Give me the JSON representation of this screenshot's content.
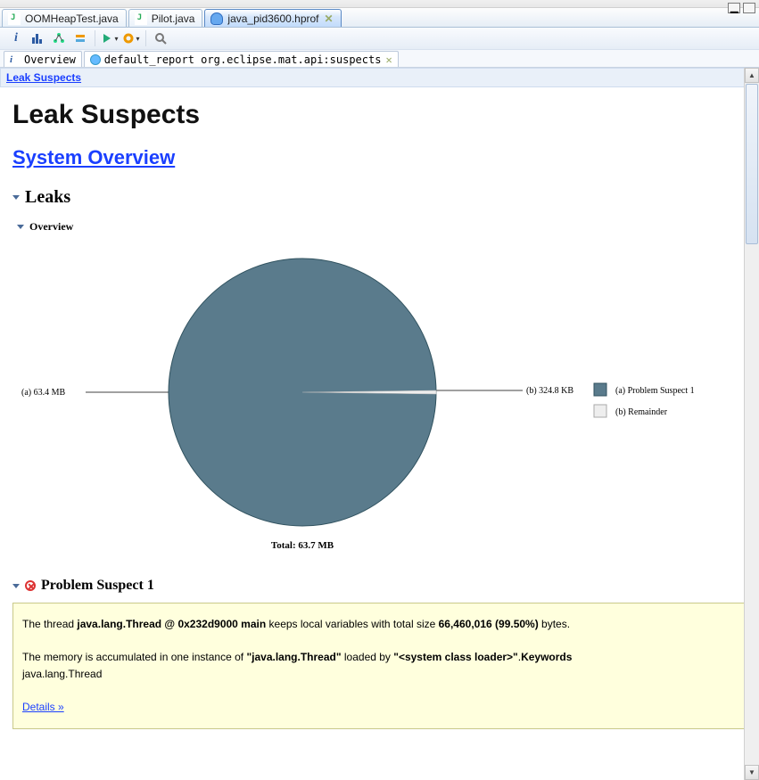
{
  "tabs": [
    {
      "label": "OOMHeapTest.java",
      "icon": "j"
    },
    {
      "label": "Pilot.java",
      "icon": "j"
    },
    {
      "label": "java_pid3600.hprof",
      "icon": "db",
      "active": true,
      "closable": true
    }
  ],
  "subtabs": [
    {
      "label": "Overview",
      "icon": "i"
    },
    {
      "label": "default_report  org.eclipse.mat.api:suspects",
      "icon": "db",
      "closable": true
    }
  ],
  "breadcrumb": {
    "label": "Leak Suspects"
  },
  "page_title": "Leak Suspects",
  "system_overview_label": "System Overview",
  "sections": {
    "leaks": "Leaks",
    "overview": "Overview",
    "problem_suspect": "Problem Suspect 1"
  },
  "chart_data": {
    "type": "pie",
    "title": "Total: 63.7 MB",
    "series": [
      {
        "name": "(a) Problem Suspect 1",
        "label": "(a)  63.4 MB",
        "value": 63.4,
        "unit": "MB",
        "percent": 99.5,
        "color": "#5a7b8c"
      },
      {
        "name": "(b) Remainder",
        "label": "(b)  324.8 KB",
        "value": 0.3172,
        "unit": "MB",
        "percent": 0.5,
        "color": "#eeeeee"
      }
    ],
    "legend": [
      {
        "swatch": "#5a7b8c",
        "label": "(a)  Problem Suspect 1"
      },
      {
        "swatch": "#eeeeee",
        "label": "(b)  Remainder"
      }
    ]
  },
  "suspect": {
    "line1_pre": "The thread ",
    "line1_bold": "java.lang.Thread @ 0x232d9000 main",
    "line1_mid": " keeps local variables with total size ",
    "line1_size": "66,460,016 (99.50%)",
    "line1_post": " bytes.",
    "line2_pre": "The memory is accumulated in one instance of ",
    "line2_q1": "\"java.lang.Thread\"",
    "line2_mid": " loaded by ",
    "line2_q2": "\"<system class loader>\"",
    "line2_post": ".",
    "line2_keywords": "Keywords",
    "line2_kw_value": "java.lang.Thread",
    "details": "Details »"
  }
}
